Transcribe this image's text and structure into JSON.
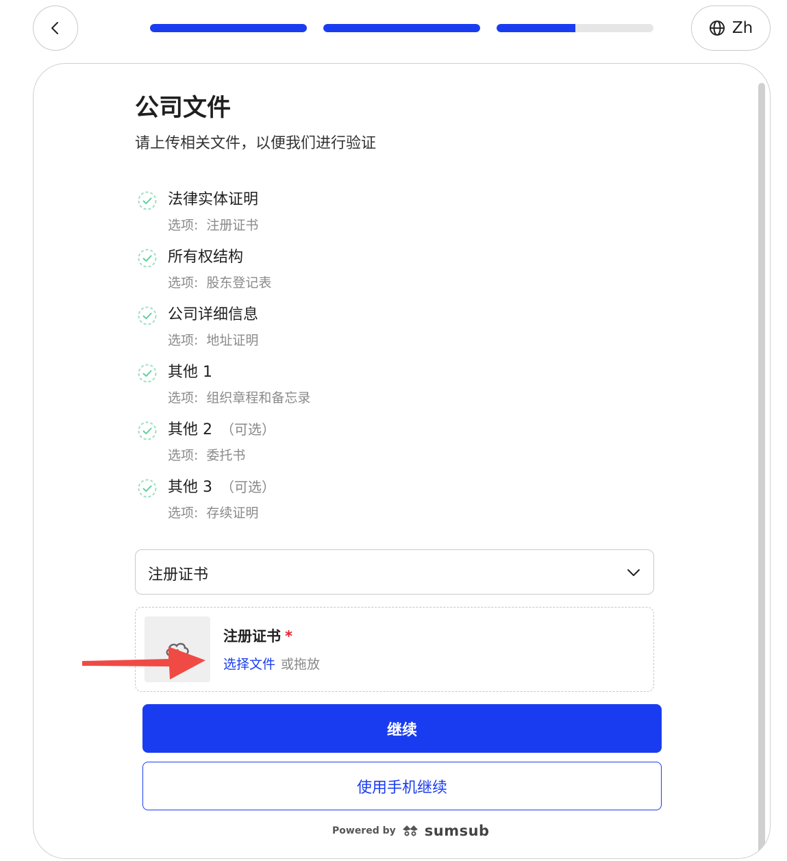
{
  "header": {
    "back_icon": "chevron-left-icon",
    "progress": [
      1.0,
      1.0,
      0.5
    ],
    "lang_icon": "globe-icon",
    "lang_label": "Zh"
  },
  "page": {
    "title": "公司文件",
    "subtitle": "请上传相关文件，以便我们进行验证"
  },
  "documents": [
    {
      "name": "法律实体证明",
      "optional_label": "",
      "option_prefix": "选项:",
      "option_value": "注册证书"
    },
    {
      "name": "所有权结构",
      "optional_label": "",
      "option_prefix": "选项:",
      "option_value": "股东登记表"
    },
    {
      "name": "公司详细信息",
      "optional_label": "",
      "option_prefix": "选项:",
      "option_value": "地址证明"
    },
    {
      "name": "其他 1",
      "optional_label": "",
      "option_prefix": "选项:",
      "option_value": "组织章程和备忘录"
    },
    {
      "name": "其他 2",
      "optional_label": "（可选）",
      "option_prefix": "选项:",
      "option_value": "委托书"
    },
    {
      "name": "其他 3",
      "optional_label": "（可选）",
      "option_prefix": "选项:",
      "option_value": "存续证明"
    }
  ],
  "doc_type_select": {
    "value": "注册证书"
  },
  "upload": {
    "title": "注册证书",
    "required_mark": "*",
    "choose_label": "选择文件",
    "drag_label": "或拖放",
    "icon": "cloud-upload-icon"
  },
  "actions": {
    "continue_label": "继续",
    "continue_phone_label": "使用手机继续"
  },
  "footer": {
    "powered_by": "Powered by",
    "brand": "sumsub"
  },
  "colors": {
    "accent": "#1a3cf0",
    "check": "#5fcf9c",
    "required": "#e0242e",
    "annotation_arrow": "#f04a45"
  }
}
